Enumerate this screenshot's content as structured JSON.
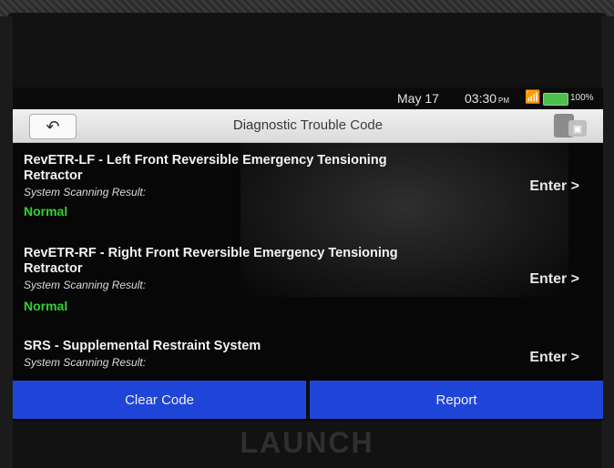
{
  "status_bar": {
    "date": "May 17",
    "time": "03:30",
    "ampm": "PM",
    "battery_pct": "100%",
    "icons": [
      "wifi-icon",
      "battery-icon"
    ]
  },
  "header": {
    "title": "Diagnostic Trouble Code",
    "back_icon": "back-arrow-icon",
    "tool_icons": [
      "tool-icon",
      "camera-icon"
    ]
  },
  "systems": [
    {
      "title": "RevETR-LF - Left Front Reversible Emergency Tensioning Retractor",
      "subtitle": "System Scanning Result:",
      "status": "Normal",
      "action": "Enter >"
    },
    {
      "title": "RevETR-RF - Right Front Reversible Emergency Tensioning Retractor",
      "subtitle": "System Scanning Result:",
      "status": "Normal",
      "action": "Enter >"
    },
    {
      "title": "SRS - Supplemental Restraint System",
      "subtitle": "System Scanning Result:",
      "status": "",
      "action": "Enter >"
    }
  ],
  "footer": {
    "clear_label": "Clear Code",
    "report_label": "Report"
  },
  "device": {
    "brand": "LAUNCH"
  },
  "colors": {
    "accent_blue": "#1f45d8",
    "normal_green": "#34d134",
    "screen_bg": "#070707"
  }
}
